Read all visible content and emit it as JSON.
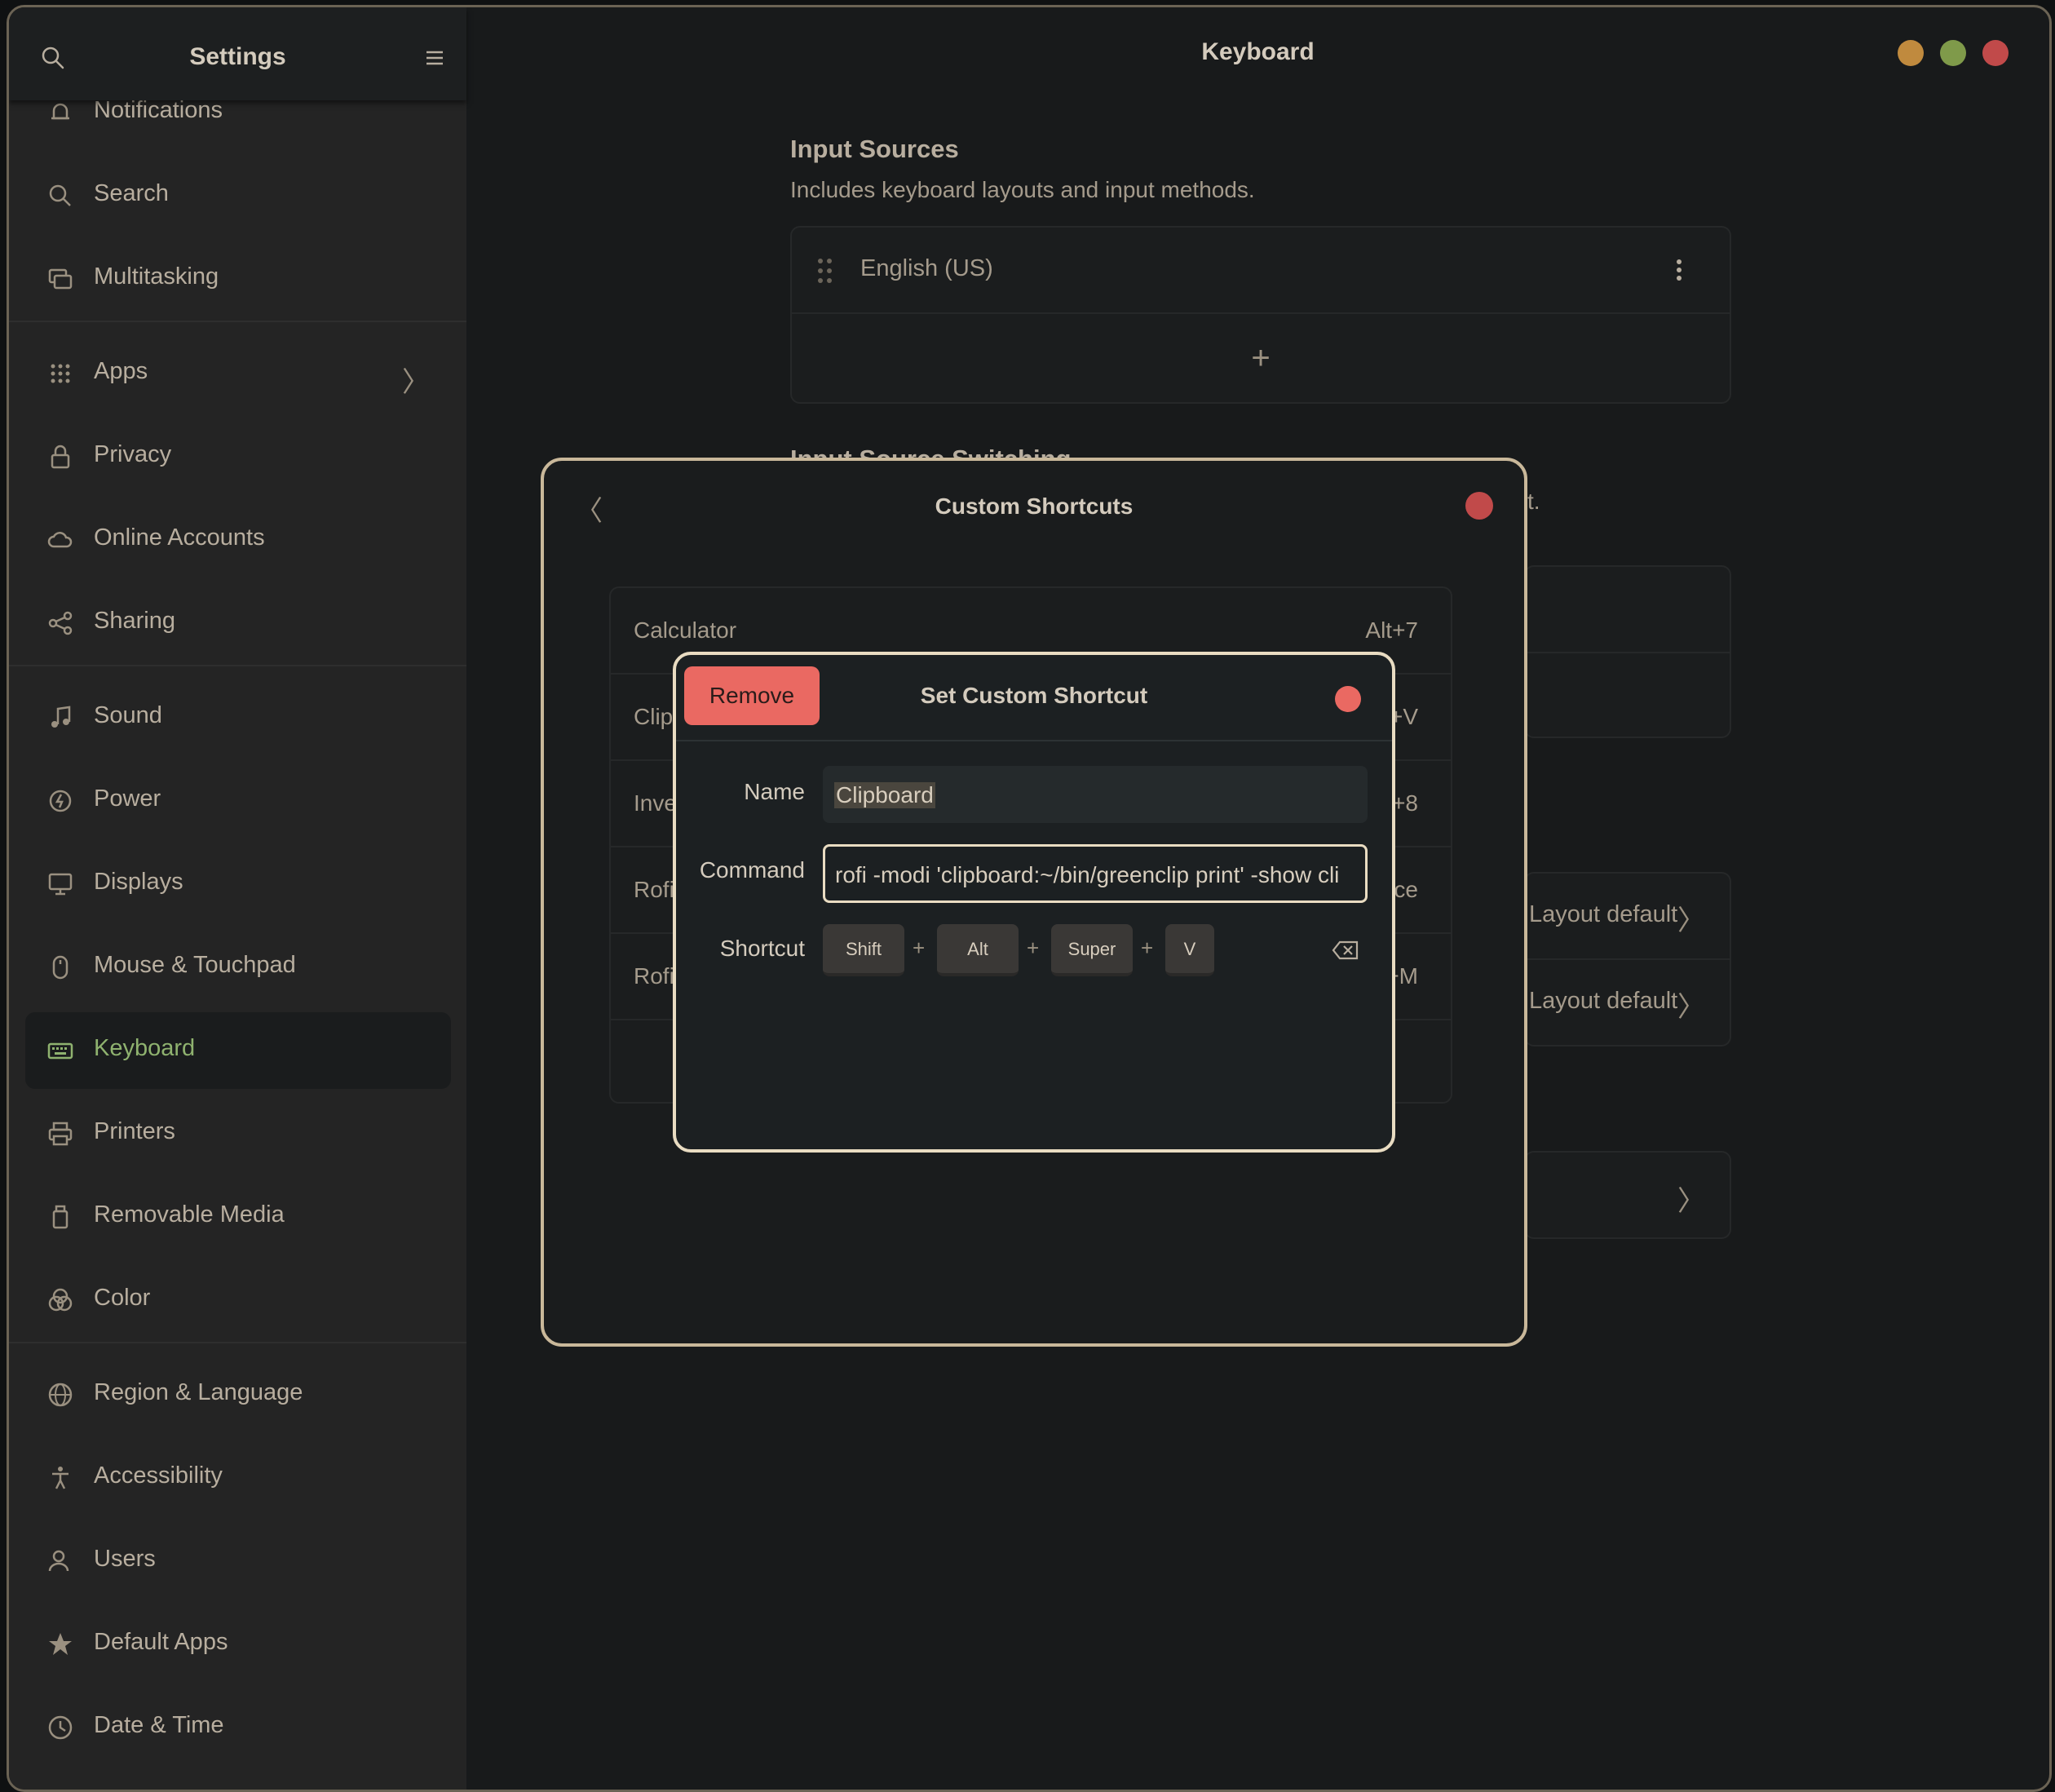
{
  "app": {
    "sidebar_title": "Settings",
    "main_title": "Keyboard"
  },
  "sidebar": {
    "items": [
      {
        "label": "Notifications"
      },
      {
        "label": "Search"
      },
      {
        "label": "Multitasking"
      },
      {
        "label": "Apps"
      },
      {
        "label": "Privacy"
      },
      {
        "label": "Online Accounts"
      },
      {
        "label": "Sharing"
      },
      {
        "label": "Sound"
      },
      {
        "label": "Power"
      },
      {
        "label": "Displays"
      },
      {
        "label": "Mouse & Touchpad"
      },
      {
        "label": "Keyboard"
      },
      {
        "label": "Printers"
      },
      {
        "label": "Removable Media"
      },
      {
        "label": "Color"
      },
      {
        "label": "Region & Language"
      },
      {
        "label": "Accessibility"
      },
      {
        "label": "Users"
      },
      {
        "label": "Default Apps"
      },
      {
        "label": "Date & Time"
      }
    ],
    "active": "Keyboard"
  },
  "input_sources": {
    "title": "Input Sources",
    "subtitle": "Includes keyboard layouts and input methods.",
    "items": [
      {
        "label": "English (US)"
      }
    ],
    "add_label": "+"
  },
  "switching": {
    "title_partial": "Input Source Switching",
    "trailing_text": "t.",
    "layout_default_1": "Layout default",
    "layout_default_2": "Layout default"
  },
  "custom_shortcuts": {
    "title": "Custom Shortcuts",
    "rows": [
      {
        "name": "Calculator",
        "shortcut": "Alt+7"
      },
      {
        "name": "Clip",
        "shortcut": "+V"
      },
      {
        "name": "Inve",
        "shortcut": "+8"
      },
      {
        "name": "Rofi",
        "shortcut": "ace"
      },
      {
        "name": "Rofi",
        "shortcut": "+M"
      }
    ]
  },
  "set_shortcut": {
    "title": "Set Custom Shortcut",
    "remove_label": "Remove",
    "name_label": "Name",
    "name_value": "Clipboard",
    "command_label": "Command",
    "command_value": "rofi -modi 'clipboard:~/bin/greenclip print' -show cli",
    "shortcut_label": "Shortcut",
    "keys": [
      "Shift",
      "Alt",
      "Super",
      "V"
    ],
    "plus": "+"
  },
  "colors": {
    "accent_green": "#8fb26f",
    "remove_red": "#ea6962",
    "close_red": "#c14a4a",
    "minimize_orange": "#c08a3e",
    "maximize_green": "#7f9a4a"
  }
}
